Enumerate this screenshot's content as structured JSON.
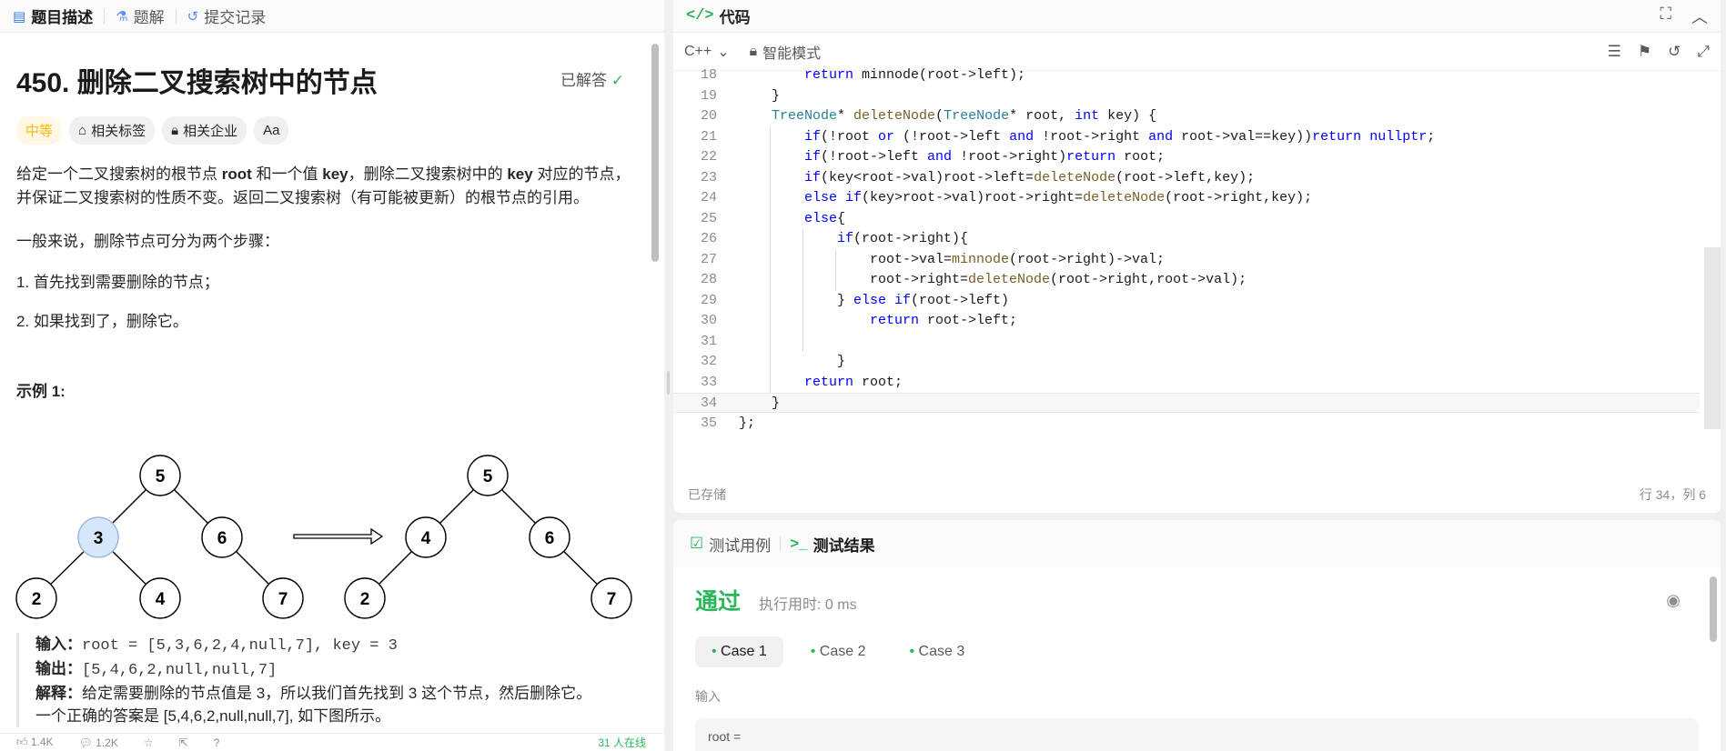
{
  "left_tabs": {
    "description": "题目描述",
    "solutions": "题解",
    "submissions": "提交记录"
  },
  "problem": {
    "title": "450. 删除二叉搜索树中的节点",
    "status": "已解答",
    "difficulty": "中等",
    "tag_related": "相关标签",
    "tag_company": "相关企业",
    "tag_font": "Aa",
    "desc_1": "给定一个二叉搜索树的根节点 ",
    "desc_root": "root",
    "desc_2": " 和一个值 ",
    "desc_key": "key",
    "desc_3": "，删除二叉搜索树中的 ",
    "desc_key2": "key",
    "desc_4": " 对应的节点，并保证二叉搜索树的性质不变。返回二叉搜索树（有可能被更新）的根节点的引用。",
    "generally": "一般来说，删除节点可分为两个步骤：",
    "step1": "1. 首先找到需要删除的节点；",
    "step2": "2. 如果找到了，删除它。",
    "example_title": "示例 1:",
    "ex_input_label": "输入：",
    "ex_input": "root = [5,3,6,2,4,null,7], key = 3",
    "ex_output_label": "输出：",
    "ex_output": "[5,4,6,2,null,null,7]",
    "ex_explain_label": "解释：",
    "ex_explain": "给定需要删除的节点值是 3，所以我们首先找到 3 这个节点，然后删除它。",
    "ex_explain2": "一个正确的答案是 [5,4,6,2,null,null,7], 如下图所示。",
    "tree_before": [
      "5",
      "3",
      "6",
      "2",
      "4",
      "7"
    ],
    "tree_after": [
      "5",
      "4",
      "6",
      "2",
      "7"
    ]
  },
  "left_footer": {
    "likes": "1.4K",
    "comments": "1.2K",
    "online": "31 人在线"
  },
  "code": {
    "header": "代码",
    "lang": "C++",
    "mode": "智能模式",
    "saved": "已存储",
    "cursor": "行 34，列 6",
    "lines": [
      {
        "n": "18",
        "indent": 3,
        "html": "<span class=\"kw\">return</span> minnode(root->left);"
      },
      {
        "n": "19",
        "indent": 2,
        "html": "}"
      },
      {
        "n": "20",
        "indent": 2,
        "html": "<span class=\"ty\">TreeNode</span>* <span class=\"fn\">deleteNode</span>(<span class=\"ty\">TreeNode</span>* root, <span class=\"kw\">int</span> key) {"
      },
      {
        "n": "21",
        "indent": 3,
        "html": "<span class=\"kw\">if</span>(!root <span class=\"kw\">or</span> (!root->left <span class=\"kw\">and</span> !root->right <span class=\"kw\">and</span> root->val==key))<span class=\"kw\">return</span> <span class=\"kw\">nullptr</span>;"
      },
      {
        "n": "22",
        "indent": 3,
        "html": "<span class=\"kw\">if</span>(!root->left <span class=\"kw\">and</span> !root->right)<span class=\"kw\">return</span> root;"
      },
      {
        "n": "23",
        "indent": 3,
        "html": "<span class=\"kw\">if</span>(key&lt;root->val)root->left=<span class=\"fn\">deleteNode</span>(root->left,key);"
      },
      {
        "n": "24",
        "indent": 3,
        "html": "<span class=\"kw\">else if</span>(key>root->val)root->right=<span class=\"fn\">deleteNode</span>(root->right,key);"
      },
      {
        "n": "25",
        "indent": 3,
        "html": "<span class=\"kw\">else</span>{"
      },
      {
        "n": "26",
        "indent": 4,
        "html": "<span class=\"kw\">if</span>(root->right){"
      },
      {
        "n": "27",
        "indent": 5,
        "html": "root->val=<span class=\"fn\">minnode</span>(root->right)->val;"
      },
      {
        "n": "28",
        "indent": 5,
        "html": "root->right=<span class=\"fn\">deleteNode</span>(root->right,root->val);"
      },
      {
        "n": "29",
        "indent": 4,
        "html": "} <span class=\"kw\">else if</span>(root->left)"
      },
      {
        "n": "30",
        "indent": 5,
        "html": "<span class=\"kw\">return</span> root->left;"
      },
      {
        "n": "31",
        "indent": 3,
        "html": ""
      },
      {
        "n": "32",
        "indent": 4,
        "html": "}"
      },
      {
        "n": "33",
        "indent": 3,
        "html": "<span class=\"kw\">return</span> root;"
      },
      {
        "n": "34",
        "indent": 2,
        "html": "}"
      },
      {
        "n": "35",
        "indent": 1,
        "html": "};"
      }
    ]
  },
  "results": {
    "tab_cases": "测试用例",
    "tab_results": "测试结果",
    "verdict": "通过",
    "runtime": "执行用时: 0 ms",
    "cases": [
      "Case 1",
      "Case 2",
      "Case 3"
    ],
    "input_label": "输入",
    "input_value": "root ="
  },
  "colors": {
    "accent_green": "#2db55d",
    "difficulty_orange": "#ffb800",
    "tree_highlight": "#d6e6fb"
  }
}
